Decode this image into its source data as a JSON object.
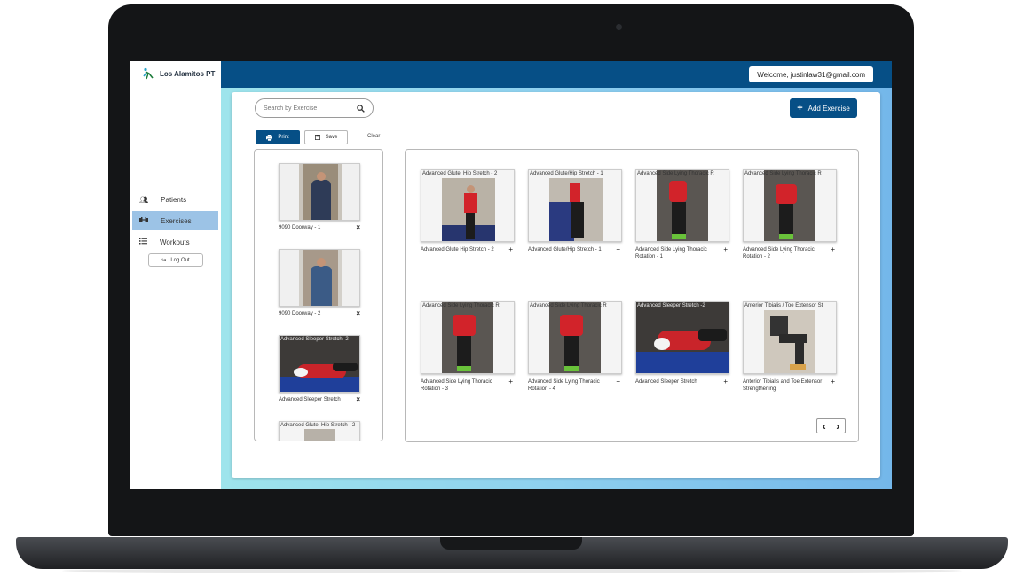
{
  "brand": {
    "name": "Los Alamitos PT"
  },
  "header": {
    "welcome": "Welcome, justinlaw31@gmail.com"
  },
  "nav": [
    {
      "label": "Patients",
      "icon": "users-icon",
      "active": false
    },
    {
      "label": "Exercises",
      "icon": "dumbbell-icon",
      "active": true
    },
    {
      "label": "Workouts",
      "icon": "list-icon",
      "active": false
    }
  ],
  "logout": {
    "label": "Log Out"
  },
  "search": {
    "placeholder": "Search by Exercise"
  },
  "toolbar": {
    "add_label": "Add Exercise",
    "print_label": "Print",
    "save_label": "Save",
    "clear_label": "Clear"
  },
  "selected": [
    {
      "caption": "",
      "label": "9090 Doorway - 1"
    },
    {
      "caption": "",
      "label": "9090 Doorway - 2"
    },
    {
      "caption": "Advanced Sleeper Stretch -2",
      "label": "Advanced Sleeper Stretch"
    },
    {
      "caption": "Advanced Glute, Hip Stretch - 2",
      "label": ""
    }
  ],
  "exercises": [
    {
      "caption": "Advanced Glute, Hip Stretch - 2",
      "label": "Advanced Glute Hip Stretch - 2"
    },
    {
      "caption": "Advanced Glute/Hip Stretch - 1",
      "label": "Advanced Glute/Hip Stretch - 1"
    },
    {
      "caption": "Advanced Side Lying Thoracic R",
      "label": "Advanced Side Lying Thoracic Rotation - 1"
    },
    {
      "caption": "Advanced Side Lying Thoracic R",
      "label": "Advanced Side Lying Thoracic Rotation - 2"
    },
    {
      "caption": "Advanced Side Lying Thoracic R",
      "label": "Advanced Side Lying Thoracic Rotation - 3"
    },
    {
      "caption": "Advanced Side Lying Thoracic R",
      "label": "Advanced Side Lying Thoracic Rotation - 4"
    },
    {
      "caption": "Advanced Sleeper Stretch -2",
      "label": "Advanced Sleeper Stretch"
    },
    {
      "caption": "Anterior Tibialis / Toe Extensor St",
      "label": "Anterior Tibialis and Toe Extensor Strengthening"
    }
  ],
  "pager": {
    "prev": "‹",
    "next": "›"
  },
  "colors": {
    "primary": "#064f86",
    "active_nav": "#9cc3e6",
    "gradient_left": "#9ee4ec",
    "gradient_right": "#74b7ea"
  }
}
